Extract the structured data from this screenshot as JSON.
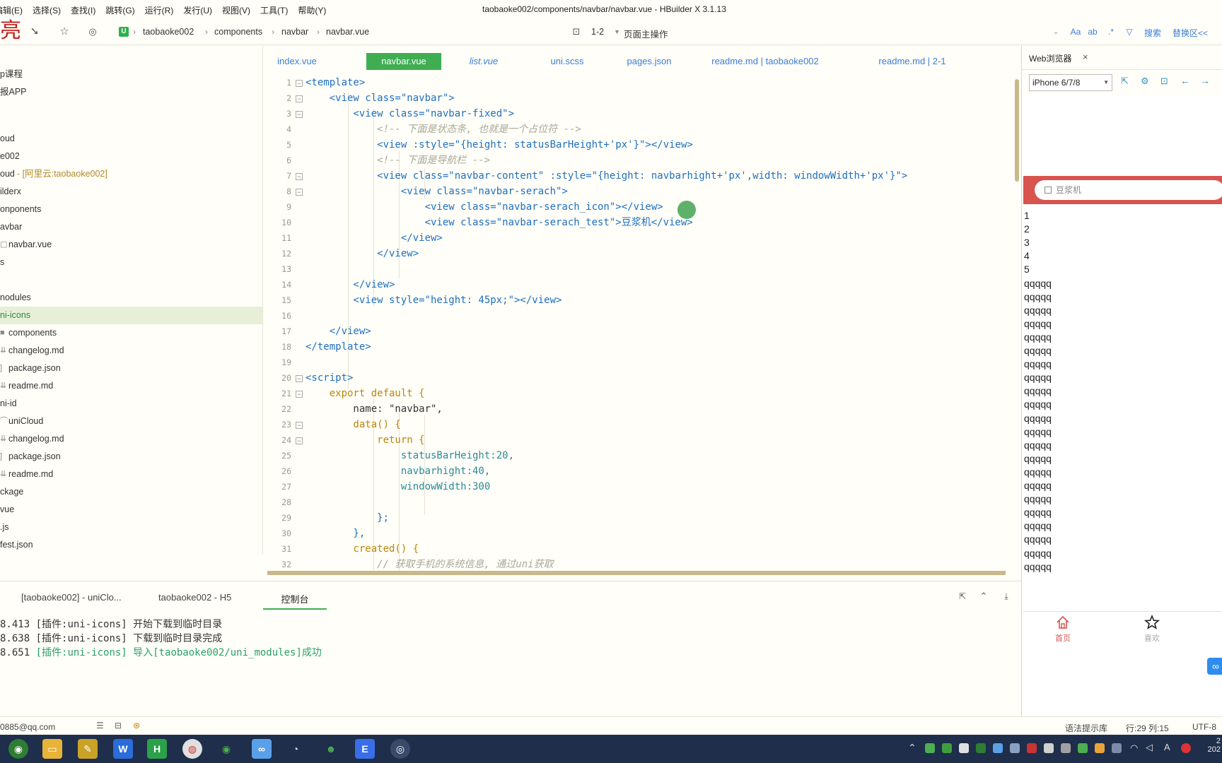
{
  "menubar": {
    "items": [
      "编辑(E)",
      "选择(S)",
      "查找(I)",
      "跳转(G)",
      "运行(R)",
      "发行(U)",
      "视图(V)",
      "工具(T)",
      "帮助(Y)"
    ],
    "window_title": "taobaoke002/components/navbar/navbar.vue - HBuilder X 3.1.13"
  },
  "toolbar": {
    "logo_glyph": "亮",
    "breadcrumb": [
      "taobaoke002",
      "components",
      "navbar",
      "navbar.vue"
    ],
    "line_range": "1-2",
    "page_action": "页面主操作",
    "search_label": "搜索",
    "replace_label": "替换区<<"
  },
  "sidebar": {
    "items": [
      {
        "label": "p课程"
      },
      {
        "label": "报APP"
      },
      {
        "label": "oud"
      },
      {
        "label": "e002"
      },
      {
        "label": "oud",
        "suffix": " - [阿里云:taobaoke002]"
      },
      {
        "label": "ilderx"
      },
      {
        "label": "onponents"
      },
      {
        "label": "avbar"
      },
      {
        "label": "navbar.vue"
      },
      {
        "label": "s"
      },
      {
        "label": ""
      },
      {
        "label": "nodules"
      },
      {
        "label": "ni-icons"
      },
      {
        "label": "components"
      },
      {
        "label": "changelog.md"
      },
      {
        "label": "package.json"
      },
      {
        "label": "readme.md"
      },
      {
        "label": "ni-id"
      },
      {
        "label": "uniCloud"
      },
      {
        "label": "changelog.md"
      },
      {
        "label": "package.json"
      },
      {
        "label": "readme.md"
      },
      {
        "label": "ckage"
      },
      {
        "label": "vue"
      },
      {
        "label": ".js"
      },
      {
        "label": "fest.json"
      }
    ]
  },
  "tabs": [
    "index.vue",
    "navbar.vue",
    "list.vue",
    "uni.scss",
    "pages.json",
    "readme.md | taobaoke002",
    "readme.md | 2-1"
  ],
  "editor": {
    "line_numbers": [
      "1",
      "2",
      "3",
      "4",
      "5",
      "6",
      "7",
      "8",
      "9",
      "10",
      "11",
      "12",
      "13",
      "14",
      "15",
      "16",
      "17",
      "18",
      "19",
      "20",
      "21",
      "22",
      "23",
      "24",
      "25",
      "26",
      "27",
      "28",
      "29",
      "30",
      "31",
      "32"
    ],
    "lines": [
      "<template>",
      "    <view class=\"navbar\">",
      "        <view class=\"navbar-fixed\">",
      "            <!-- 下面是状态条, 也就是一个占位符 -->",
      "            <view :style=\"{height: statusBarHeight+'px'}\"></view>",
      "            <!-- 下面是导航栏 -->",
      "            <view class=\"navbar-content\" :style=\"{height: navbarhight+'px',width: windowWidth+'px'}\">",
      "                <view class=\"navbar-serach\">",
      "                    <view class=\"navbar-serach_icon\"></view>",
      "                    <view class=\"navbar-serach_test\">豆浆机</view>",
      "                </view>",
      "            </view>",
      "",
      "        </view>",
      "        <view style=\"height: 45px;\"></view>",
      "",
      "    </view>",
      "</template>",
      "",
      "<script>",
      "    export default {",
      "        name: \"navbar\",",
      "        data() {",
      "            return {",
      "                statusBarHeight:20,",
      "                navbarhight:40,",
      "                windowWidth:300",
      "",
      "            };",
      "        },",
      "        created() {",
      "            // 获取手机的系统信息, 通过uni获取"
    ]
  },
  "console": {
    "tabs": [
      "[taobaoke002] - uniClo...",
      "taobaoke002 - H5",
      "控制台"
    ],
    "lines": [
      {
        "time": "8.413",
        "text": " [插件:uni-icons] 开始下载到临时目录"
      },
      {
        "time": "8.638",
        "text": " [插件:uni-icons] 下载到临时目录完成"
      },
      {
        "time": "8.651",
        "text": " [插件:uni-icons] 导入[taobaoke002/uni_modules]成功"
      }
    ]
  },
  "statusbar": {
    "account": "0885@qq.com",
    "hint_lib": "语法提示库",
    "position": "行:29   列:15",
    "encoding": "UTF-8"
  },
  "browser": {
    "tab_label": "Web浏览器",
    "device": "iPhone 6/7/8",
    "search_placeholder": "豆浆机",
    "list": [
      "1",
      "2",
      "3",
      "4",
      "5",
      "qqqqq",
      "qqqqq",
      "qqqqq",
      "qqqqq",
      "qqqqq",
      "qqqqq",
      "qqqqq",
      "qqqqq",
      "qqqqq",
      "qqqqq",
      "qqqqq",
      "qqqqq",
      "qqqqq",
      "qqqqq",
      "qqqqq",
      "qqqqq",
      "qqqqq",
      "qqqqq",
      "qqqqq",
      "qqqqq",
      "qqqqq",
      "qqqqq"
    ],
    "tabbar": [
      "首页",
      "喜欢"
    ]
  },
  "colors": {
    "accent_green": "#3fae52",
    "navbar_red": "#d9534f",
    "link_blue": "#3b7dd8"
  },
  "taskbar": {
    "clock_time": "2",
    "clock_date": "202"
  }
}
